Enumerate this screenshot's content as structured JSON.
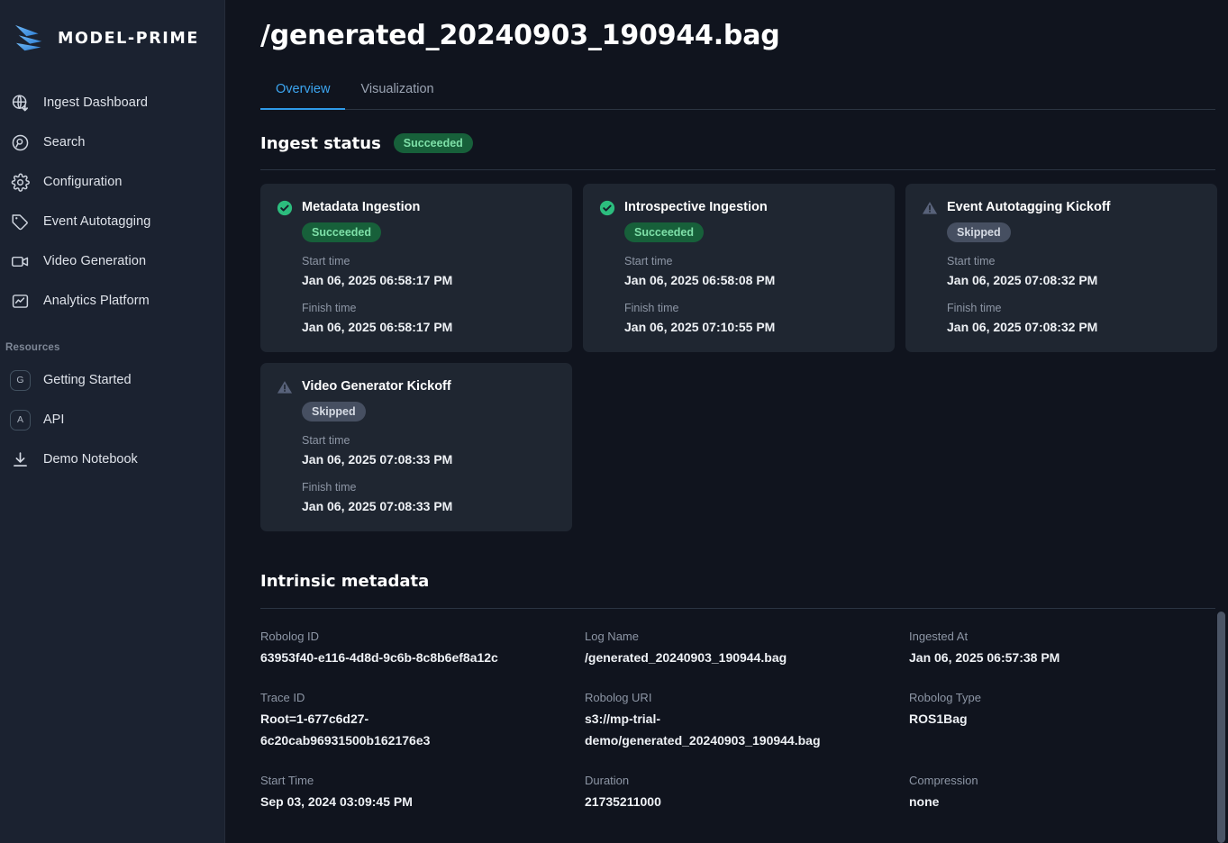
{
  "brand": {
    "name": "MODEL-PRIME",
    "logo_icon": "wing-logo-icon",
    "accent_color": "#4f9fe8"
  },
  "sidebar": {
    "items": [
      {
        "label": "Ingest Dashboard",
        "icon": "globe-download-icon"
      },
      {
        "label": "Search",
        "icon": "search-pin-icon"
      },
      {
        "label": "Configuration",
        "icon": "gear-icon"
      },
      {
        "label": "Event Autotagging",
        "icon": "tag-icon"
      },
      {
        "label": "Video Generation",
        "icon": "video-camera-icon"
      },
      {
        "label": "Analytics Platform",
        "icon": "analytics-chart-icon"
      }
    ],
    "resources_label": "Resources",
    "resources": [
      {
        "label": "Getting Started",
        "icon": "letter-g-badge-icon",
        "glyph": "G"
      },
      {
        "label": "API",
        "icon": "letter-a-badge-icon",
        "glyph": "A"
      },
      {
        "label": "Demo Notebook",
        "icon": "download-icon",
        "glyph": ""
      }
    ]
  },
  "header": {
    "title": "/generated_20240903_190944.bag"
  },
  "tabs": [
    {
      "label": "Overview",
      "active": true
    },
    {
      "label": "Visualization",
      "active": false
    }
  ],
  "ingest_status": {
    "title": "Ingest status",
    "overall_badge": "Succeeded",
    "overall_badge_color": "#17603a",
    "start_time_label": "Start time",
    "finish_time_label": "Finish time",
    "cards": [
      {
        "title": "Metadata Ingestion",
        "status": "Succeeded",
        "status_kind": "success",
        "icon": "check-circle-icon",
        "start_time": "Jan 06, 2025 06:58:17 PM",
        "finish_time": "Jan 06, 2025 06:58:17 PM"
      },
      {
        "title": "Introspective Ingestion",
        "status": "Succeeded",
        "status_kind": "success",
        "icon": "check-circle-icon",
        "start_time": "Jan 06, 2025 06:58:08 PM",
        "finish_time": "Jan 06, 2025 07:10:55 PM"
      },
      {
        "title": "Event Autotagging Kickoff",
        "status": "Skipped",
        "status_kind": "skipped",
        "icon": "warning-triangle-icon",
        "start_time": "Jan 06, 2025 07:08:32 PM",
        "finish_time": "Jan 06, 2025 07:08:32 PM"
      },
      {
        "title": "Video Generator Kickoff",
        "status": "Skipped",
        "status_kind": "skipped",
        "icon": "warning-triangle-icon",
        "start_time": "Jan 06, 2025 07:08:33 PM",
        "finish_time": "Jan 06, 2025 07:08:33 PM"
      }
    ]
  },
  "intrinsic_metadata": {
    "title": "Intrinsic metadata",
    "fields": [
      {
        "label": "Robolog ID",
        "value": "63953f40-e116-4d8d-9c6b-8c8b6ef8a12c"
      },
      {
        "label": "Log Name",
        "value": "/generated_20240903_190944.bag"
      },
      {
        "label": "Ingested At",
        "value": "Jan 06, 2025 06:57:38 PM"
      },
      {
        "label": "Trace ID",
        "value": "Root=1-677c6d27-6c20cab96931500b162176e3"
      },
      {
        "label": "Robolog URI",
        "value": "s3://mp-trial-demo/generated_20240903_190944.bag"
      },
      {
        "label": "Robolog Type",
        "value": "ROS1Bag"
      },
      {
        "label": "Start Time",
        "value": "Sep 03, 2024 03:09:45 PM"
      },
      {
        "label": "Duration",
        "value": "21735211000"
      },
      {
        "label": "Compression",
        "value": "none"
      }
    ]
  }
}
